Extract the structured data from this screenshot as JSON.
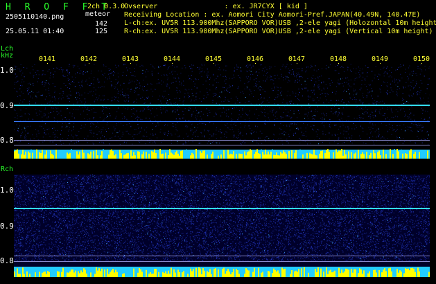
{
  "header": {
    "logo": "H R O F F T",
    "channel": "2ch 0.3.0",
    "mode": "meteor",
    "filename": "2505110140.png",
    "datetime": "25.05.11 01:40",
    "count_l": "142",
    "count_r": "125",
    "observer": "Ovserver                : ex. JR7CYX [ kid ]",
    "location": "Receiving Location : ex. Aomori City Aomori-Pref.JAPAN(40.49N, 140.47E)",
    "lch_info": "L-ch:ex. UV5R 113.900Mhz(SAPPORO VOR)USB ,2-ele yagi (Holozontal 10m height)",
    "rch_info": "R-ch:ex. UV5R 113.900Mhz(SAPPORO VOR)USB ,2-ele yagi (Vertical 10m height)"
  },
  "axis": {
    "lch_label": "Lch",
    "unit": "kHz",
    "rch_label": "Rch",
    "time_ticks": [
      "0141",
      "0142",
      "0143",
      "0144",
      "0145",
      "0146",
      "0147",
      "0148",
      "0149",
      "0150"
    ],
    "freq_ticks_l": [
      "1.0",
      "0.9",
      "0.8"
    ],
    "freq_ticks_r": [
      "1.0",
      "0.9",
      "0.8"
    ]
  },
  "colors": {
    "text_green": "#2aff2a",
    "text_yellow": "#ffff33",
    "signal_cyan": "#33ddff",
    "noise_blue": "#1a2aa0",
    "level_yellow": "#ffff00"
  }
}
